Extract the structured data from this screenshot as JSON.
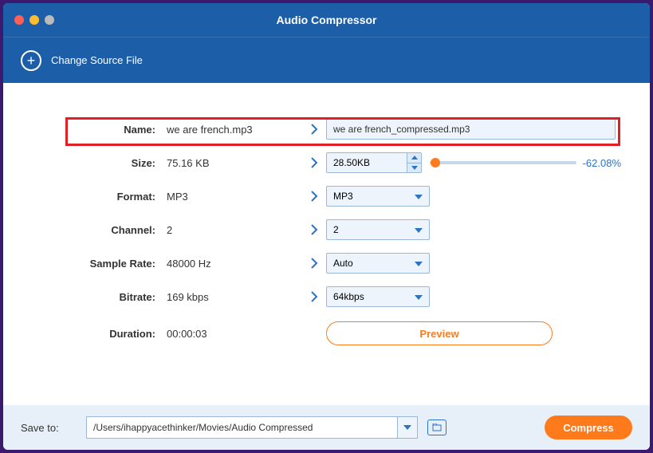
{
  "window": {
    "title": "Audio Compressor"
  },
  "toolbar": {
    "change_source": "Change Source File"
  },
  "labels": {
    "name": "Name:",
    "size": "Size:",
    "format": "Format:",
    "channel": "Channel:",
    "sample_rate": "Sample Rate:",
    "bitrate": "Bitrate:",
    "duration": "Duration:"
  },
  "original": {
    "name": "we are french.mp3",
    "size": "75.16 KB",
    "format": "MP3",
    "channel": "2",
    "sample_rate": "48000 Hz",
    "bitrate": "169 kbps",
    "duration": "00:00:03"
  },
  "output": {
    "name": "we are french_compressed.mp3",
    "size": "28.50KB",
    "size_pct": "-62.08%",
    "format": "MP3",
    "channel": "2",
    "sample_rate": "Auto",
    "bitrate": "64kbps",
    "preview": "Preview"
  },
  "footer": {
    "save_to_label": "Save to:",
    "save_path": "/Users/ihappyacethinker/Movies/Audio Compressed",
    "compress": "Compress"
  }
}
